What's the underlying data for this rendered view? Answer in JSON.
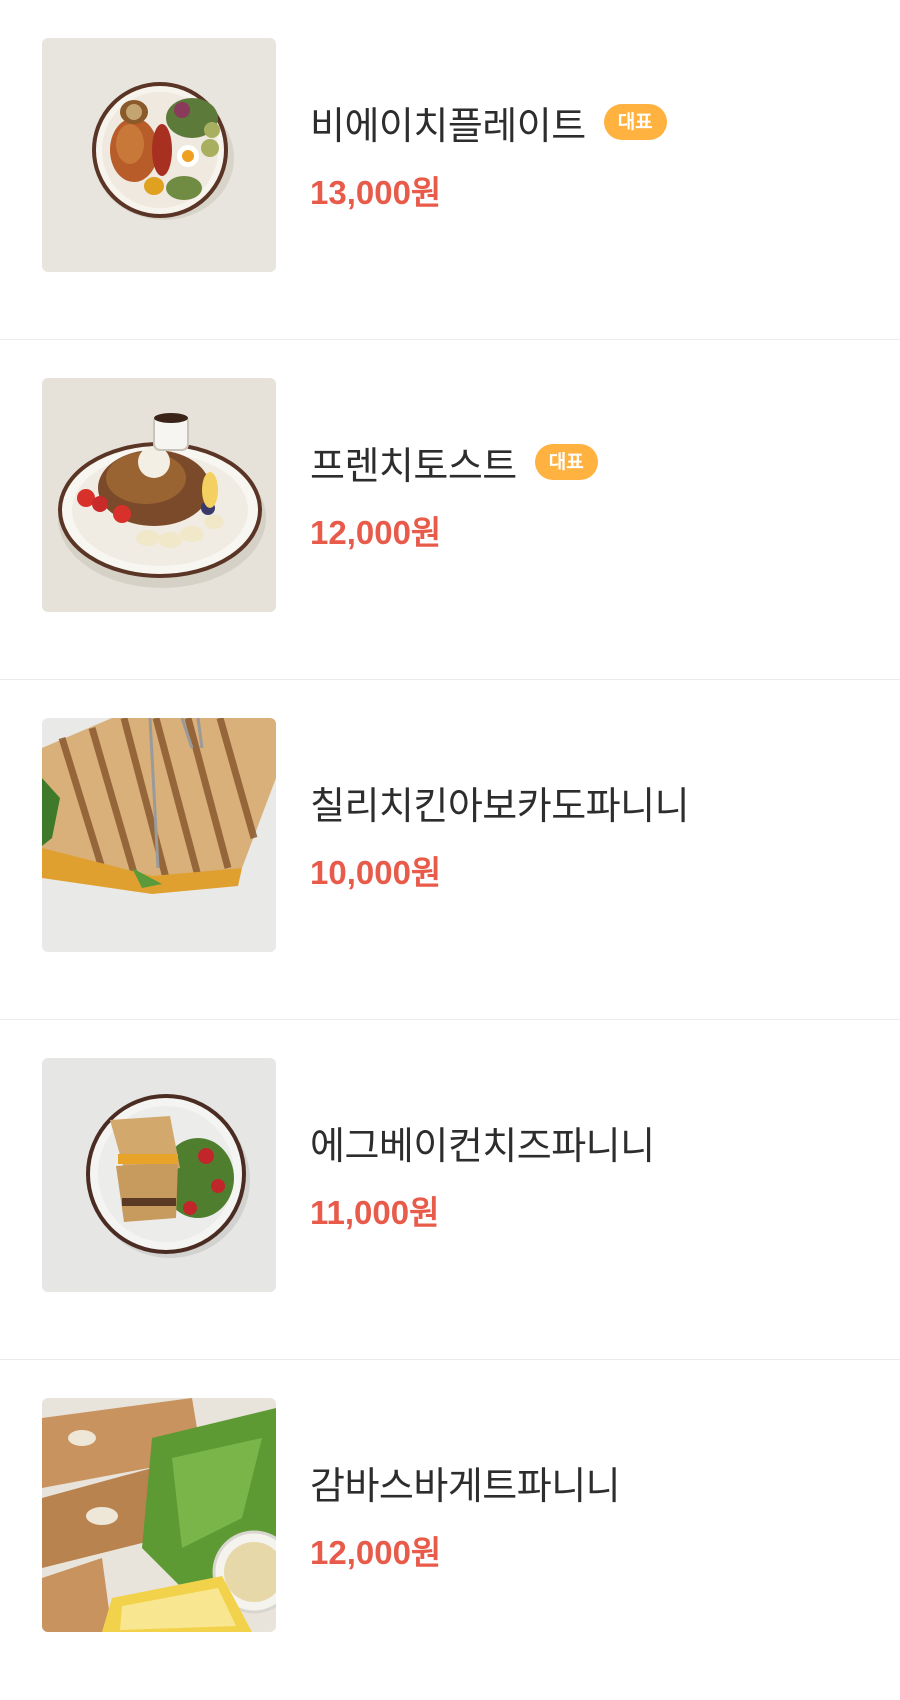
{
  "menu": {
    "items": [
      {
        "name": "비에이치플레이트",
        "badge": "대표",
        "price": "13,000원",
        "image_icon": "plate-photo"
      },
      {
        "name": "프렌치토스트",
        "badge": "대표",
        "price": "12,000원",
        "image_icon": "french-toast-photo"
      },
      {
        "name": "칠리치킨아보카도파니니",
        "badge": null,
        "price": "10,000원",
        "image_icon": "panini-photo"
      },
      {
        "name": "에그베이컨치즈파니니",
        "badge": null,
        "price": "11,000원",
        "image_icon": "panini-salad-photo"
      },
      {
        "name": "감바스바게트파니니",
        "badge": null,
        "price": "12,000원",
        "image_icon": "baguette-photo"
      }
    ]
  },
  "colors": {
    "badge_bg": "#ffb23f",
    "price": "#e85a4a",
    "divider": "#ebebeb"
  }
}
